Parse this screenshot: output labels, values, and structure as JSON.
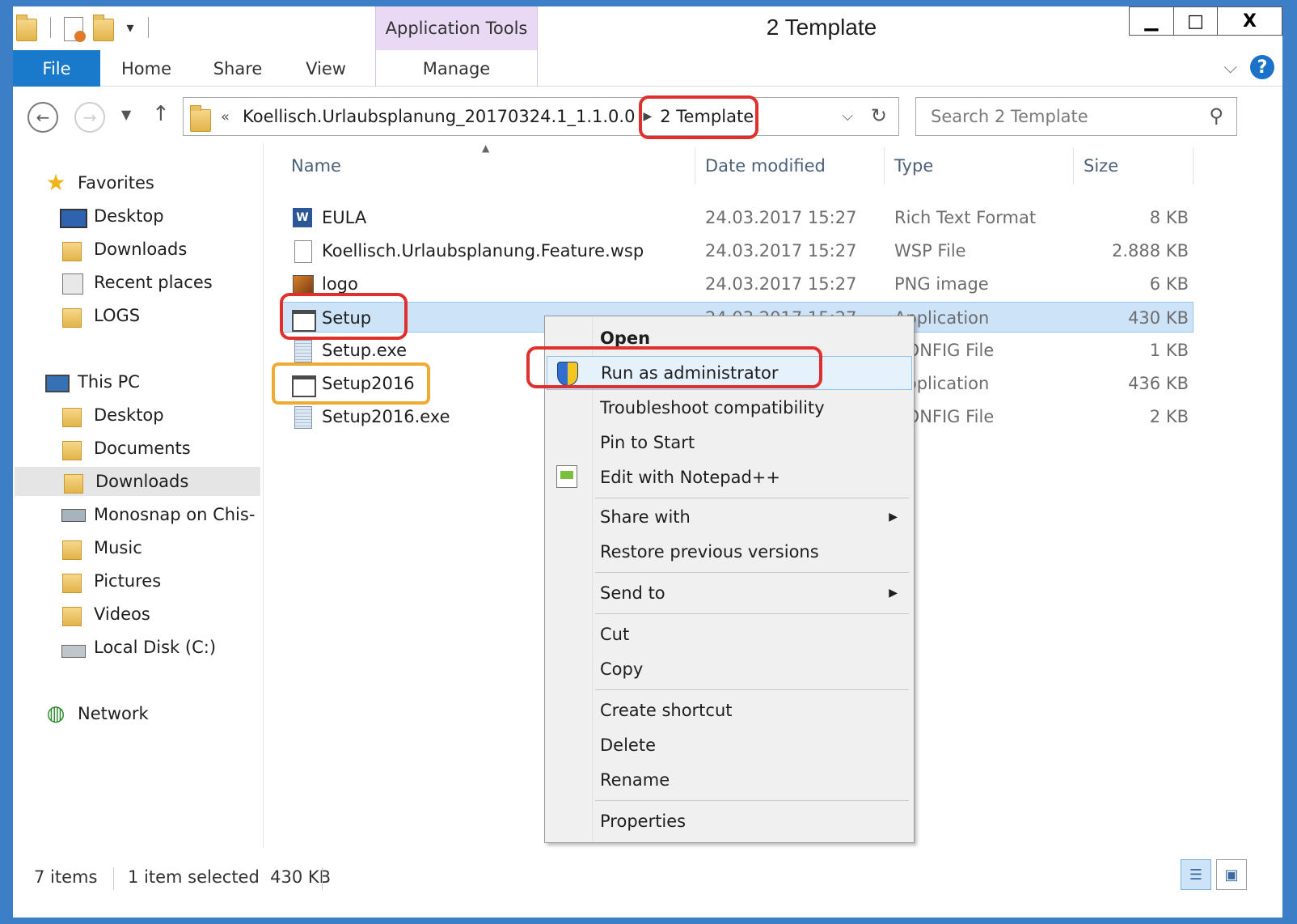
{
  "window": {
    "title": "2 Template",
    "context_tab_group": "Application Tools",
    "controls": {
      "minimize": "▁",
      "maximize": "□",
      "close": "X"
    }
  },
  "ribbon": {
    "tabs": [
      "File",
      "Home",
      "Share",
      "View",
      "Manage"
    ],
    "help": "?"
  },
  "nav": {
    "back_icon": "back-arrow-icon",
    "forward_icon": "forward-arrow-icon",
    "breadcrumb_prefix": "«",
    "path_parent": "Koellisch.Urlaubsplanung_20170324.1_1.1.0.0",
    "path_current": "2 Template",
    "search_placeholder": "Search 2 Template"
  },
  "sidebar": {
    "favorites_label": "Favorites",
    "favorites": [
      "Desktop",
      "Downloads",
      "Recent places",
      "LOGS"
    ],
    "this_pc_label": "This PC",
    "this_pc": [
      "Desktop",
      "Documents",
      "Downloads",
      "Monosnap on Chis-",
      "Music",
      "Pictures",
      "Videos",
      "Local Disk (C:)"
    ],
    "network_label": "Network",
    "selected": "Downloads"
  },
  "columns": {
    "name": "Name",
    "date": "Date modified",
    "type": "Type",
    "size": "Size"
  },
  "files": [
    {
      "name": "EULA",
      "date": "24.03.2017 15:27",
      "type": "Rich Text Format",
      "size": "8 KB",
      "icon": "rtf"
    },
    {
      "name": "Koellisch.Urlaubsplanung.Feature.wsp",
      "date": "24.03.2017 15:27",
      "type": "WSP File",
      "size": "2.888 KB",
      "icon": "blank"
    },
    {
      "name": "logo",
      "date": "24.03.2017 15:27",
      "type": "PNG image",
      "size": "6 KB",
      "icon": "png"
    },
    {
      "name": "Setup",
      "date": "24.03.2017 15:27",
      "type": "Application",
      "size": "430 KB",
      "icon": "app"
    },
    {
      "name": "Setup.exe",
      "date": "",
      "type": "CONFIG File",
      "size": "1 KB",
      "icon": "cfg"
    },
    {
      "name": "Setup2016",
      "date": "",
      "type": "Application",
      "size": "436 KB",
      "icon": "app"
    },
    {
      "name": "Setup2016.exe",
      "date": "",
      "type": "CONFIG File",
      "size": "2 KB",
      "icon": "cfg"
    }
  ],
  "context_menu": [
    "Open",
    "Run as administrator",
    "Troubleshoot compatibility",
    "Pin to Start",
    "Edit with Notepad++",
    "Share with",
    "Restore previous versions",
    "Send to",
    "Cut",
    "Copy",
    "Create shortcut",
    "Delete",
    "Rename",
    "Properties"
  ],
  "status": {
    "item_count": "7 items",
    "selection": "1 item selected  430 KB"
  },
  "colors": {
    "accent": "#1979ca",
    "selection": "#cde3f8",
    "highlight_red": "#e0302e",
    "highlight_orange": "#efab31"
  }
}
